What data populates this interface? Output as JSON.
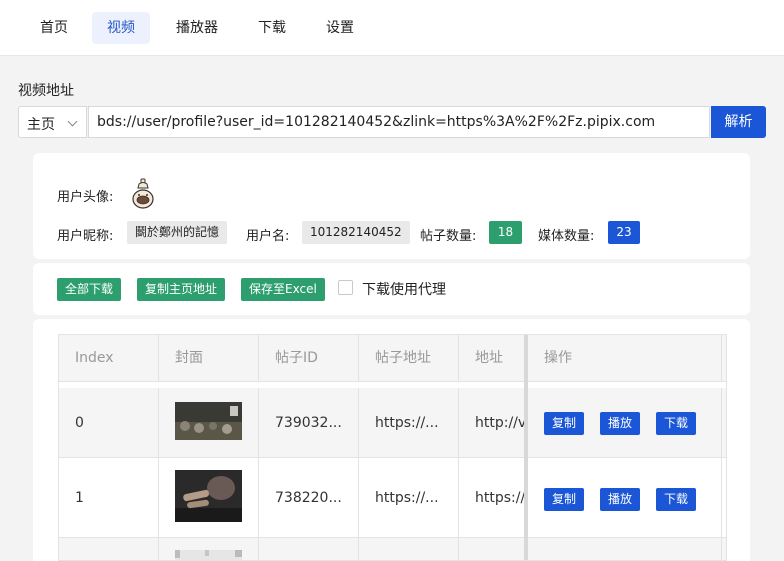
{
  "nav": {
    "tabs": [
      "首页",
      "视频",
      "播放器",
      "下载",
      "设置"
    ],
    "active": "视频"
  },
  "url_section": {
    "label": "视频地址",
    "select_value": "主页",
    "url": "bds://user/profile?user_id=101282140452&zlink=https%3A%2F%2Fz.pipix.com",
    "parse_button": "解析"
  },
  "user": {
    "avatar_label": "用户头像:",
    "nickname_label": "用户昵称:",
    "nickname": "鬬於鄭州的記憶",
    "username_label": "用户名:",
    "username": "101282140452",
    "posts_label": "帖子数量:",
    "posts_count": "18",
    "media_label": "媒体数量:",
    "media_count": "23",
    "colors": {
      "green": "#2d9f6f",
      "blue": "#1a56d6"
    }
  },
  "actions": {
    "download_all": "全部下载",
    "copy_home": "复制主页地址",
    "save_excel": "保存至Excel",
    "proxy_label": "下载使用代理",
    "proxy_checked": false
  },
  "table": {
    "columns": [
      "Index",
      "封面",
      "帖子ID",
      "帖子地址",
      "地址",
      "操作"
    ],
    "rows": [
      {
        "index": "0",
        "post_id": "739032...",
        "post_url": "https://...",
        "address": "http://v",
        "cover_icon": "video-thumbnail-icon"
      },
      {
        "index": "1",
        "post_id": "738220...",
        "post_url": "https://...",
        "address": "https://",
        "cover_icon": "video-thumbnail-icon"
      }
    ],
    "op_buttons": {
      "copy": "复制",
      "play": "播放",
      "download": "下载"
    }
  }
}
